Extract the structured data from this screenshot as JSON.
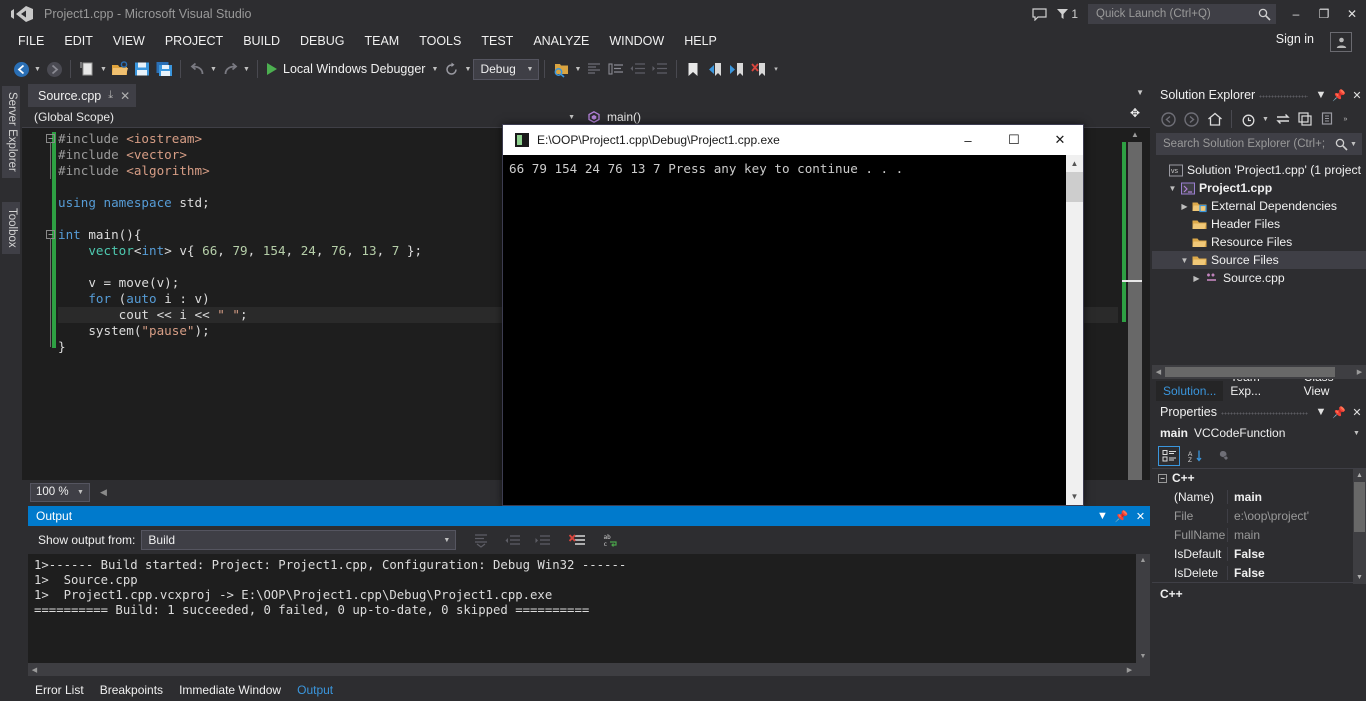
{
  "window": {
    "title": "Project1.cpp - Microsoft Visual Studio",
    "minimize": "–",
    "maximize": "❐",
    "close": "✕"
  },
  "titlebar": {
    "notification_count": "1",
    "quick_launch_placeholder": "Quick Launch (Ctrl+Q)",
    "quick_launch_value": ""
  },
  "menu": {
    "items": [
      {
        "label": "FILE"
      },
      {
        "label": "EDIT"
      },
      {
        "label": "VIEW"
      },
      {
        "label": "PROJECT"
      },
      {
        "label": "BUILD"
      },
      {
        "label": "DEBUG"
      },
      {
        "label": "TEAM"
      },
      {
        "label": "TOOLS"
      },
      {
        "label": "TEST"
      },
      {
        "label": "ANALYZE"
      },
      {
        "label": "WINDOW"
      },
      {
        "label": "HELP"
      }
    ],
    "sign_in": "Sign in"
  },
  "toolbar": {
    "start_debug_label": "Local Windows Debugger",
    "configuration": "Debug",
    "caret": "▼"
  },
  "left_tabs": [
    {
      "label": "Server Explorer"
    },
    {
      "label": "Toolbox"
    }
  ],
  "editor": {
    "tab": {
      "filename": "Source.cpp",
      "pin": "⤓",
      "close": "✕"
    },
    "scope": "(Global Scope)",
    "member": "main()",
    "zoom_level": "100 %",
    "code": [
      {
        "indent": 0,
        "fold": "minus",
        "segments": [
          {
            "t": "#include ",
            "c": "tok-pp"
          },
          {
            "t": "<iostream>",
            "c": "tok-inc"
          }
        ]
      },
      {
        "indent": 0,
        "segments": [
          {
            "t": "#include ",
            "c": "tok-pp"
          },
          {
            "t": "<vector>",
            "c": "tok-inc"
          }
        ]
      },
      {
        "indent": 0,
        "segments": [
          {
            "t": "#include ",
            "c": "tok-pp"
          },
          {
            "t": "<algorithm>",
            "c": "tok-inc"
          }
        ]
      },
      {
        "indent": 0,
        "segments": [
          {
            "t": "",
            "c": "tok-plain"
          }
        ]
      },
      {
        "indent": 0,
        "segments": [
          {
            "t": "using",
            "c": "tok-kw"
          },
          {
            "t": " ",
            "c": "tok-plain"
          },
          {
            "t": "namespace",
            "c": "tok-kw"
          },
          {
            "t": " std;",
            "c": "tok-plain"
          }
        ]
      },
      {
        "indent": 0,
        "segments": [
          {
            "t": "",
            "c": "tok-plain"
          }
        ]
      },
      {
        "indent": 0,
        "fold": "minus",
        "segments": [
          {
            "t": "int",
            "c": "tok-kw"
          },
          {
            "t": " main(){",
            "c": "tok-plain"
          }
        ]
      },
      {
        "indent": 4,
        "segments": [
          {
            "t": "vector",
            "c": "tok-type"
          },
          {
            "t": "<",
            "c": "tok-plain"
          },
          {
            "t": "int",
            "c": "tok-kw"
          },
          {
            "t": "> v{ ",
            "c": "tok-plain"
          },
          {
            "t": "66",
            "c": "tok-num"
          },
          {
            "t": ", ",
            "c": "tok-plain"
          },
          {
            "t": "79",
            "c": "tok-num"
          },
          {
            "t": ", ",
            "c": "tok-plain"
          },
          {
            "t": "154",
            "c": "tok-num"
          },
          {
            "t": ", ",
            "c": "tok-plain"
          },
          {
            "t": "24",
            "c": "tok-num"
          },
          {
            "t": ", ",
            "c": "tok-plain"
          },
          {
            "t": "76",
            "c": "tok-num"
          },
          {
            "t": ", ",
            "c": "tok-plain"
          },
          {
            "t": "13",
            "c": "tok-num"
          },
          {
            "t": ", ",
            "c": "tok-plain"
          },
          {
            "t": "7",
            "c": "tok-num"
          },
          {
            "t": " };",
            "c": "tok-plain"
          }
        ]
      },
      {
        "indent": 0,
        "segments": [
          {
            "t": "",
            "c": "tok-plain"
          }
        ]
      },
      {
        "indent": 4,
        "segments": [
          {
            "t": "v = move(v);",
            "c": "tok-plain"
          }
        ]
      },
      {
        "indent": 4,
        "segments": [
          {
            "t": "for",
            "c": "tok-kw"
          },
          {
            "t": " (",
            "c": "tok-plain"
          },
          {
            "t": "auto",
            "c": "tok-kw"
          },
          {
            "t": " i : v)",
            "c": "tok-plain"
          }
        ]
      },
      {
        "indent": 8,
        "highlight": true,
        "segments": [
          {
            "t": "cout << i << ",
            "c": "tok-plain"
          },
          {
            "t": "\" \"",
            "c": "tok-str"
          },
          {
            "t": ";",
            "c": "tok-plain"
          }
        ]
      },
      {
        "indent": 4,
        "segments": [
          {
            "t": "system(",
            "c": "tok-plain"
          },
          {
            "t": "\"pause\"",
            "c": "tok-str"
          },
          {
            "t": ");",
            "c": "tok-plain"
          }
        ]
      },
      {
        "indent": 0,
        "segments": [
          {
            "t": "}",
            "c": "tok-plain"
          }
        ]
      }
    ]
  },
  "console": {
    "title": "E:\\OOP\\Project1.cpp\\Debug\\Project1.cpp.exe",
    "minimize": "–",
    "maximize": "☐",
    "close": "✕",
    "output": "66 79 154 24 76 13 7 Press any key to continue . . ."
  },
  "output_panel": {
    "title": "Output",
    "show_output_from_label": "Show output from:",
    "source": "Build",
    "lines": [
      "1>------ Build started: Project: Project1.cpp, Configuration: Debug Win32 ------",
      "1>  Source.cpp",
      "1>  Project1.cpp.vcxproj -> E:\\OOP\\Project1.cpp\\Debug\\Project1.cpp.exe",
      "========== Build: 1 succeeded, 0 failed, 0 up-to-date, 0 skipped =========="
    ]
  },
  "bottom_tabs": [
    {
      "label": "Error List",
      "active": false
    },
    {
      "label": "Breakpoints",
      "active": false
    },
    {
      "label": "Immediate Window",
      "active": false
    },
    {
      "label": "Output",
      "active": true
    }
  ],
  "solution_explorer": {
    "title": "Solution Explorer",
    "search_placeholder": "Search Solution Explorer (Ctrl+;",
    "search_value": "",
    "tree": [
      {
        "depth": 0,
        "twisty": "",
        "icon": "solution-icon",
        "label": "Solution 'Project1.cpp' (1 project",
        "bold": false,
        "selected": false
      },
      {
        "depth": 1,
        "twisty": "▼",
        "icon": "project-icon",
        "label": "Project1.cpp",
        "bold": true,
        "selected": false
      },
      {
        "depth": 2,
        "twisty": "▶",
        "icon": "folder-ref-icon",
        "label": "External Dependencies",
        "bold": false,
        "selected": false
      },
      {
        "depth": 2,
        "twisty": "",
        "icon": "folder-icon",
        "label": "Header Files",
        "bold": false,
        "selected": false
      },
      {
        "depth": 2,
        "twisty": "",
        "icon": "folder-icon",
        "label": "Resource Files",
        "bold": false,
        "selected": false
      },
      {
        "depth": 2,
        "twisty": "▼",
        "icon": "folder-icon",
        "label": "Source Files",
        "bold": false,
        "selected": true
      },
      {
        "depth": 3,
        "twisty": "▶",
        "icon": "cpp-file-icon",
        "label": "Source.cpp",
        "bold": false,
        "selected": false
      }
    ]
  },
  "dock_tabs": [
    {
      "label": "Solution...",
      "active": true
    },
    {
      "label": "Team Exp...",
      "active": false
    },
    {
      "label": "Class View",
      "active": false
    }
  ],
  "properties": {
    "title": "Properties",
    "selected_name": "main",
    "selected_type": "VCCodeFunction",
    "category": "C++",
    "rows": [
      {
        "name": "(Name)",
        "value": "main",
        "name_dim": false,
        "value_bold": true
      },
      {
        "name": "File",
        "value": "e:\\oop\\project'",
        "name_dim": true,
        "value_bold": false
      },
      {
        "name": "FullName",
        "value": "main",
        "name_dim": true,
        "value_bold": false
      },
      {
        "name": "IsDefault",
        "value": "False",
        "name_dim": false,
        "value_bold": true
      },
      {
        "name": "IsDelete",
        "value": "False",
        "name_dim": false,
        "value_bold": true
      }
    ],
    "description": "C++"
  },
  "colors": {
    "accent": "#007acc",
    "chrome": "#2d2d30",
    "editor_bg": "#1e1e1e",
    "panel_bg": "#252526",
    "changebar_green": "#2ea043",
    "link_blue": "#3a96dd"
  }
}
